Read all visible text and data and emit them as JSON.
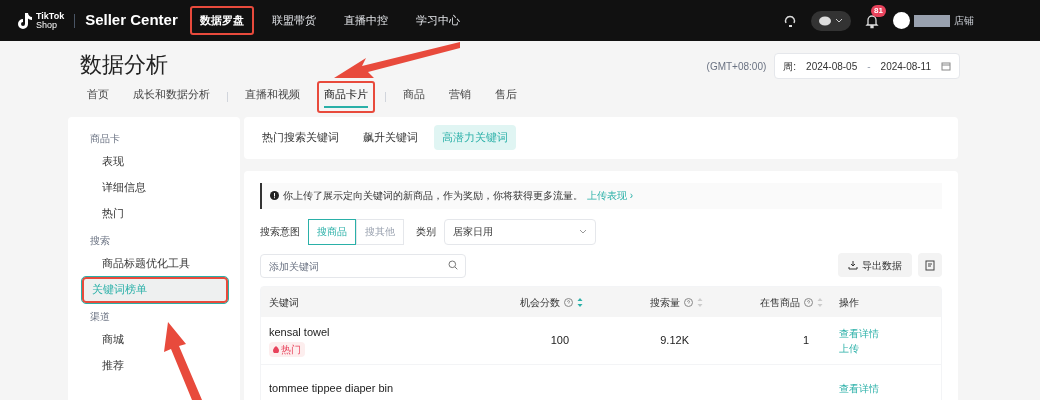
{
  "topbar": {
    "logo_line1": "TikTok",
    "logo_line2": "Shop",
    "brand": "Seller Center",
    "nav": [
      {
        "label": "数据罗盘",
        "selected": true,
        "annotated": true
      },
      {
        "label": "联盟带货",
        "selected": false,
        "annotated": false
      },
      {
        "label": "直播中控",
        "selected": false,
        "annotated": false
      },
      {
        "label": "学习中心",
        "selected": false,
        "annotated": false
      }
    ],
    "notification_count": "81",
    "store_label": "店铺"
  },
  "page": {
    "title": "数据分析",
    "timezone": "(GMT+08:00)",
    "date_prefix": "周:",
    "date_start": "2024-08-05",
    "date_separator": "-",
    "date_end": "2024-08-11"
  },
  "tab_groups": [
    {
      "tabs": [
        {
          "label": "首页",
          "selected": false,
          "annotated": false
        },
        {
          "label": "成长和数据分析",
          "selected": false,
          "annotated": false
        }
      ]
    },
    {
      "tabs": [
        {
          "label": "直播和视频",
          "selected": false,
          "annotated": false
        },
        {
          "label": "商品卡片",
          "selected": true,
          "annotated": true
        }
      ]
    },
    {
      "tabs": [
        {
          "label": "商品",
          "selected": false,
          "annotated": false
        },
        {
          "label": "营销",
          "selected": false,
          "annotated": false
        },
        {
          "label": "售后",
          "selected": false,
          "annotated": false
        }
      ]
    }
  ],
  "sidebar": {
    "groups": [
      {
        "heading": "商品卡",
        "items": [
          {
            "label": "表现",
            "selected": false,
            "annotated": false
          },
          {
            "label": "详细信息",
            "selected": false,
            "annotated": false
          },
          {
            "label": "热门",
            "selected": false,
            "annotated": false
          }
        ]
      },
      {
        "heading": "搜索",
        "items": [
          {
            "label": "商品标题优化工具",
            "selected": false,
            "annotated": false
          },
          {
            "label": "关键词榜单",
            "selected": true,
            "annotated": true
          }
        ]
      },
      {
        "heading": "渠道",
        "items": [
          {
            "label": "商城",
            "selected": false,
            "annotated": false
          },
          {
            "label": "推荐",
            "selected": false,
            "annotated": false
          }
        ]
      }
    ]
  },
  "keyword_tabs": [
    {
      "label": "热门搜索关键词",
      "selected": false
    },
    {
      "label": "飙升关键词",
      "selected": false
    },
    {
      "label": "高潜力关键词",
      "selected": true
    }
  ],
  "notice": {
    "text": "你上传了展示定向关键词的新商品，作为奖励，你将获得更多流量。",
    "link": "上传表现 ›"
  },
  "filters": {
    "intent_label": "搜索意图",
    "intent_options": [
      {
        "label": "搜商品",
        "selected": true
      },
      {
        "label": "搜其他",
        "selected": false
      }
    ],
    "category_label": "类别",
    "category_value": "居家日用",
    "search_placeholder": "添加关键词",
    "export_button": "导出数据"
  },
  "table": {
    "columns": [
      {
        "label": "关键词",
        "help": false,
        "sortable": false
      },
      {
        "label": "机会分数",
        "help": true,
        "sortable": true,
        "sort_active": true
      },
      {
        "label": "搜索量",
        "help": true,
        "sortable": true,
        "sort_active": false
      },
      {
        "label": "在售商品",
        "help": true,
        "sortable": true,
        "sort_active": false
      },
      {
        "label": "操作",
        "help": false,
        "sortable": false
      }
    ],
    "rows": [
      {
        "keyword": "kensal towel",
        "tag": "热门",
        "score": "100",
        "search_volume": "9.12K",
        "products": "1",
        "actions": [
          "查看详情",
          "上传"
        ]
      },
      {
        "keyword": "tommee tippee diaper bin",
        "actions": [
          "查看详情"
        ]
      }
    ]
  }
}
